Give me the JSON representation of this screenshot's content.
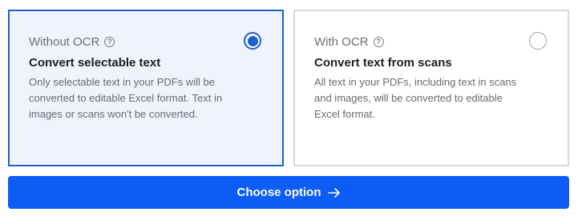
{
  "options": [
    {
      "heading": "Without OCR",
      "help_icon": "question-circle-icon",
      "title": "Convert selectable text",
      "description": "Only selectable text in your PDFs will be converted to editable Excel format. Text in images or scans won't be converted.",
      "selected": true
    },
    {
      "heading": "With OCR",
      "help_icon": "question-circle-icon",
      "title": "Convert text from scans",
      "description": "All text in your PDFs, including text in scans and images, will be converted to editable Excel format.",
      "selected": false
    }
  ],
  "action": {
    "label": "Choose option",
    "icon": "arrow-right-icon"
  },
  "colors": {
    "accent": "#0d5cf5",
    "selected_border": "#1a5fd0",
    "selected_bg": "#eef3fd"
  }
}
